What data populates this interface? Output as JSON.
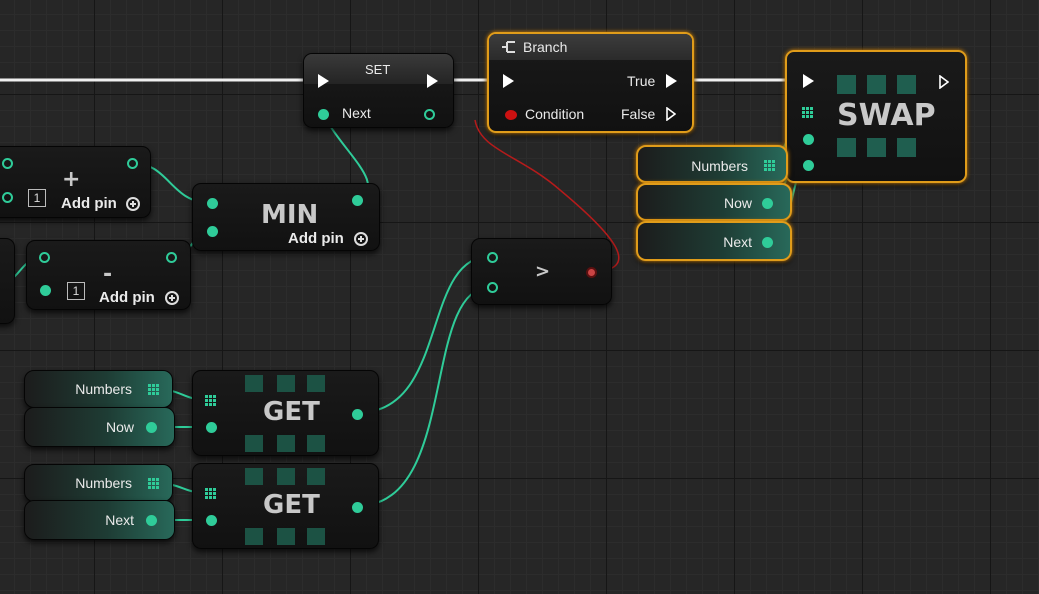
{
  "graph": {
    "set_node": {
      "title": "SET",
      "pin_label": "Next"
    },
    "branch_node": {
      "title": "Branch",
      "true_label": "True",
      "false_label": "False",
      "condition_label": "Condition"
    },
    "swap_node": {
      "title": "SWAP"
    },
    "min_node": {
      "title": "MIN",
      "add_pin_label": "Add pin"
    },
    "add_node": {
      "symbol": "+",
      "default_value": "1",
      "add_pin_label": "Add pin"
    },
    "subtract_node": {
      "symbol": "-",
      "default_value": "1",
      "add_pin_label": "Add pin"
    },
    "compare_node": {
      "symbol": ">"
    },
    "get_nodes": [
      {
        "title": "GET",
        "array_var": "Numbers",
        "index_var": "Now"
      },
      {
        "title": "GET",
        "array_var": "Numbers",
        "index_var": "Next"
      }
    ],
    "swap_inputs": [
      "Numbers",
      "Now",
      "Next"
    ],
    "colors": {
      "exec": "#ffffff",
      "integer_pin": "#2fcc99",
      "bool_pin": "#cc1111",
      "selection": "#e09c1a",
      "background": "#262626"
    },
    "icons": [
      "branch-icon",
      "array-grid-icon",
      "add-pin-icon"
    ]
  }
}
